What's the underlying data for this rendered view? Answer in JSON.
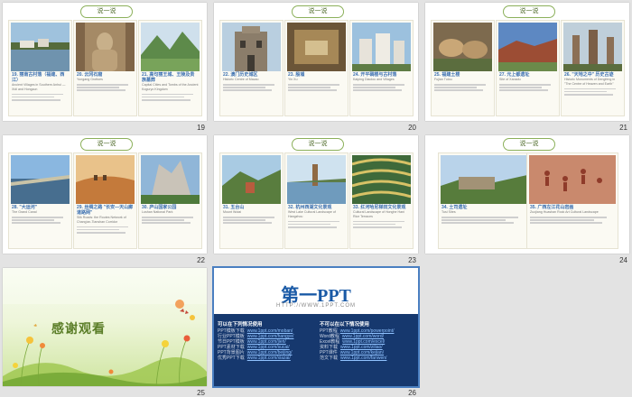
{
  "slides": [
    {
      "number": "19",
      "pill": "说一说",
      "cards": [
        {
          "title": "19. 丽南古村落（福建、西江）",
          "sub": "Ancient Villages in Southern Anhui — Xidi and Hongcun",
          "pic": "village"
        },
        {
          "title": "20. 云冈石窟",
          "sub": "Yungang Grottoes",
          "pic": "buddha"
        },
        {
          "title": "21. 高句丽王城、王陵及贵族墓葬",
          "sub": "Capital Cities and Tombs of the Ancient Koguryo Kingdom",
          "pic": "mountains"
        }
      ]
    },
    {
      "number": "20",
      "pill": "说一说",
      "cards": [
        {
          "title": "22. 澳门历史城区",
          "sub": "Historic Centre of Macao",
          "pic": "ruins"
        },
        {
          "title": "23. 殷墟",
          "sub": "Yin Xu",
          "pic": "room"
        },
        {
          "title": "24. 开平碉楼与古村落",
          "sub": "Kaiping Diaolou and Villages",
          "pic": "towers"
        }
      ]
    },
    {
      "number": "21",
      "pill": "说一说",
      "cards": [
        {
          "title": "25. 福建土楼",
          "sub": "Fujian Tulou",
          "pic": "tulou"
        },
        {
          "title": "27. 元上都遗址",
          "sub": "Site of Xanadu",
          "pic": "redrock"
        },
        {
          "title": "26. \"天地之中\" 历史古迹",
          "sub": "Historic Monuments of Dengfeng in \"The Centre of Heaven and Earth\"",
          "pic": "pagoda"
        }
      ]
    },
    {
      "number": "22",
      "pill": "说一说",
      "cards": [
        {
          "title": "28. \"大运河\"",
          "sub": "The Grand Canal",
          "pic": "canal"
        },
        {
          "title": "29. 丝绸之路 \"长安—天山廊道路网\"",
          "sub": "Silk Roads: the Routes Network of Chang'an-Tianshan Corridor",
          "pic": "desert"
        },
        {
          "title": "30. 庐山国家公园",
          "sub": "Lushan National Park",
          "pic": "cliff"
        }
      ]
    },
    {
      "number": "23",
      "pill": "说一说",
      "cards": [
        {
          "title": "31. 五台山",
          "sub": "Mount Wutai",
          "pic": "wutai"
        },
        {
          "title": "32. 杭州西湖文化景观",
          "sub": "West Lake Cultural Landscape of Hangzhou",
          "pic": "westlake"
        },
        {
          "title": "33. 红河哈尼梯田文化景观",
          "sub": "Cultural Landscape of Honghe Hani Rice Terraces",
          "pic": "terraces"
        }
      ]
    },
    {
      "number": "24",
      "pill": "说一说",
      "cards": [
        {
          "title": "34. 土司遗址",
          "sub": "Tusi Sites",
          "pic": "fort"
        },
        {
          "title": "35. 广西左江花山岩画",
          "sub": "Zuojiang Huashan Rock Art Cultural Landscape",
          "pic": "rockart"
        }
      ]
    }
  ],
  "thanks_slide": {
    "number": "25",
    "text": "感谢观看"
  },
  "logo_slide": {
    "number": "26",
    "logo": "第一PPT",
    "url": "HTTP://WWW.1PPT.COM",
    "left_title": "可以在下列情况使用",
    "left_rows": [
      {
        "k": "PPT模板下载",
        "v": "www.1ppt.com/moban/"
      },
      {
        "k": "行业PPT模板",
        "v": "www.1ppt.com/hangye/"
      },
      {
        "k": "节日PPT模板",
        "v": "www.1ppt.com/jieri/"
      },
      {
        "k": "PPT素材下载",
        "v": "www.1ppt.com/sucai/"
      },
      {
        "k": "PPT背景图片",
        "v": "www.1ppt.com/beijing/"
      },
      {
        "k": "优秀PPT下载",
        "v": "www.1ppt.com/xiazai/"
      }
    ],
    "right_title": "不可以在以下情况使用",
    "right_rows": [
      {
        "k": "PPT教程",
        "v": "www.1ppt.com/powerpoint/"
      },
      {
        "k": "Word教程",
        "v": "www.1ppt.com/word/"
      },
      {
        "k": "Excel教程",
        "v": "www.1ppt.com/excel/"
      },
      {
        "k": "资料下载",
        "v": "www.1ppt.com/ziliao/"
      },
      {
        "k": "PPT课件",
        "v": "www.1ppt.com/kejian/"
      },
      {
        "k": "范文下载",
        "v": "www.1ppt.com/fanwen/"
      }
    ]
  },
  "colors": {
    "pill_border": "#8bb05a",
    "title_blue": "#3a6fb0",
    "panel_navy": "#16386e",
    "selection": "#4a7fc1"
  }
}
